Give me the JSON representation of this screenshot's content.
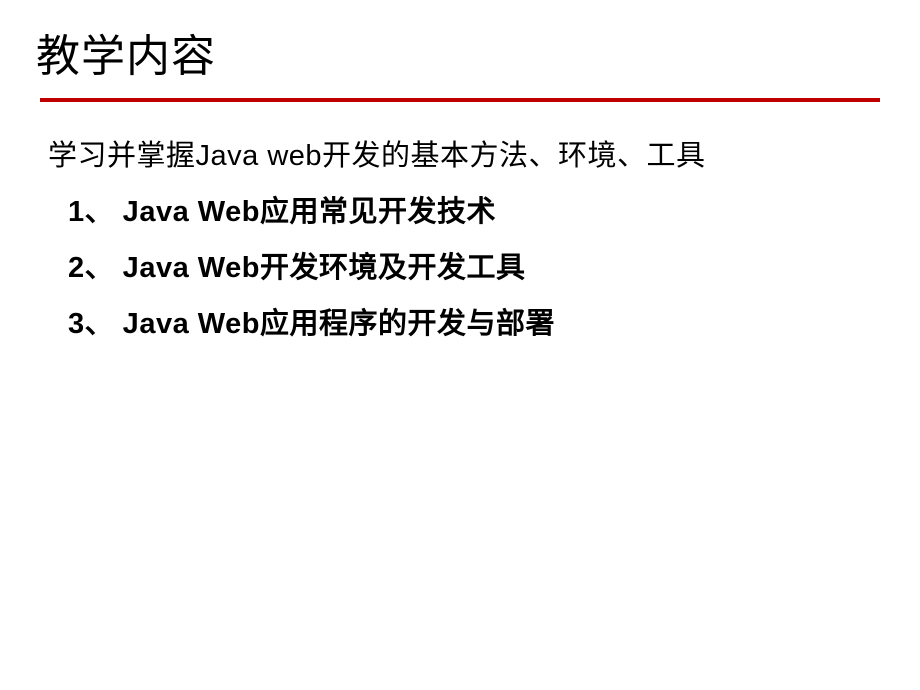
{
  "slide": {
    "title": "教学内容",
    "intro": "学习并掌握Java web开发的基本方法、环境、工具",
    "items": [
      "1、 Java Web应用常见开发技术",
      "2、  Java Web开发环境及开发工具",
      "3、 Java Web应用程序的开发与部署"
    ]
  }
}
